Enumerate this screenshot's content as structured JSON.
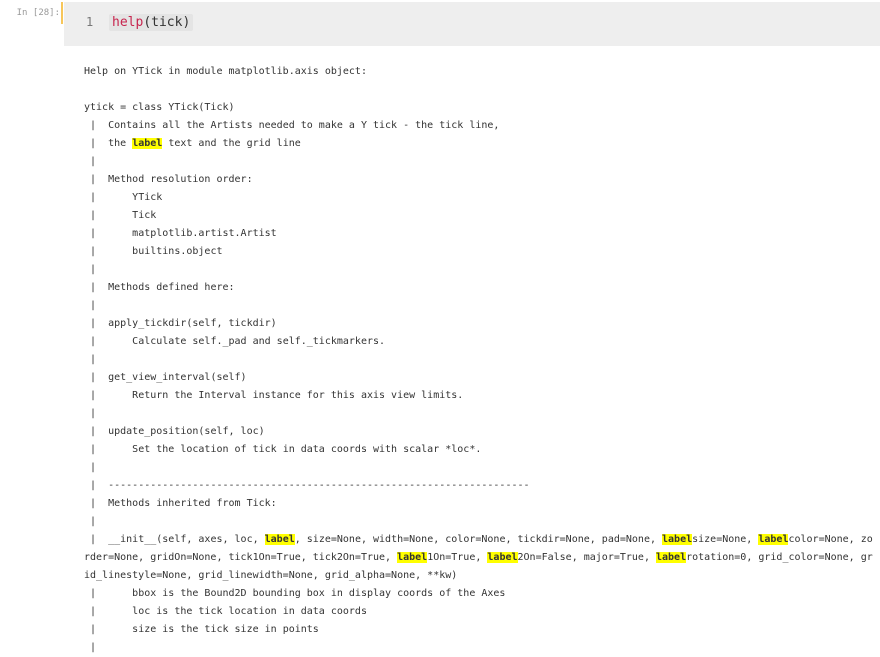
{
  "input_cell": {
    "prompt": "In [28]:",
    "line_number": "1",
    "code_fn": "help",
    "code_args": "(tick)"
  },
  "output": {
    "highlight_term": "label",
    "lines": [
      "Help on YTick in module matplotlib.axis object:",
      "",
      "ytick = class YTick(Tick)",
      " |  Contains all the Artists needed to make a Y tick - the tick line,",
      " |  the label text and the grid line",
      " |  ",
      " |  Method resolution order:",
      " |      YTick",
      " |      Tick",
      " |      matplotlib.artist.Artist",
      " |      builtins.object",
      " |  ",
      " |  Methods defined here:",
      " |  ",
      " |  apply_tickdir(self, tickdir)",
      " |      Calculate self._pad and self._tickmarkers.",
      " |  ",
      " |  get_view_interval(self)",
      " |      Return the Interval instance for this axis view limits.",
      " |  ",
      " |  update_position(self, loc)",
      " |      Set the location of tick in data coords with scalar *loc*.",
      " |  ",
      " |  ----------------------------------------------------------------------",
      " |  Methods inherited from Tick:",
      " |  ",
      " |  __init__(self, axes, loc, label, size=None, width=None, color=None, tickdir=None, pad=None, labelsize=None, labelcolor=None, zorder=None, gridOn=None, tick1On=True, tick2On=True, label1On=True, label2On=False, major=True, labelrotation=0, grid_color=None, grid_linestyle=None, grid_linewidth=None, grid_alpha=None, **kw)",
      " |      bbox is the Bound2D bounding box in display coords of the Axes",
      " |      loc is the tick location in data coords",
      " |      size is the tick size in points",
      " |  "
    ]
  }
}
